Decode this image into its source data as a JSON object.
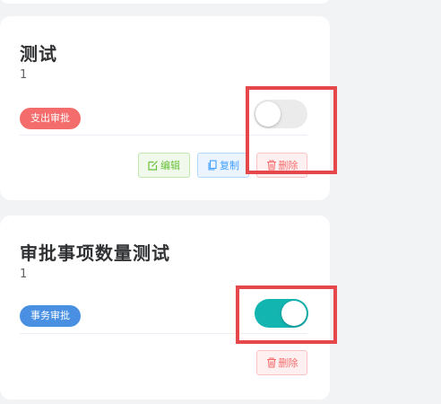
{
  "cards": [
    {
      "title": "测试",
      "count": "1",
      "tag": "支出审批",
      "enabled": false,
      "actions": {
        "edit": "编辑",
        "copy": "复制",
        "delete": "删除"
      }
    },
    {
      "title": "审批事项数量测试",
      "count": "1",
      "tag": "事务审批",
      "enabled": true,
      "actions": {
        "delete": "删除"
      }
    }
  ],
  "colors": {
    "tag_red": "#f56c6c",
    "tag_blue": "#4a90e2",
    "toggle_on": "#13b5b1",
    "highlight": "#e5474b"
  }
}
